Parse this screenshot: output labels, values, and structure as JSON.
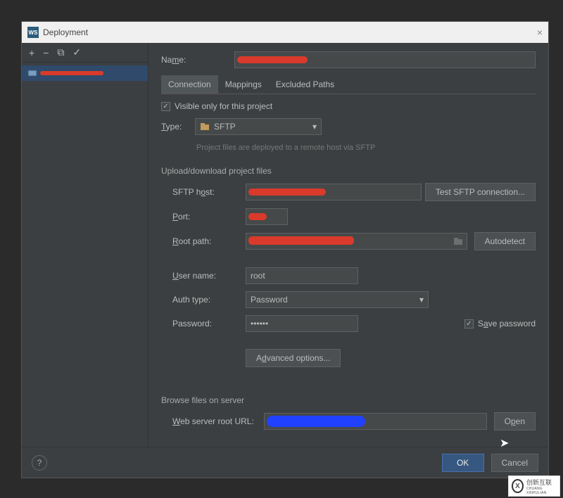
{
  "titlebar": {
    "title": "Deployment",
    "icon_text": "WS"
  },
  "toolbar": {
    "add": "+",
    "remove": "−",
    "copy": "⧉",
    "apply": "✓"
  },
  "sidebar": {
    "item_redacted": true
  },
  "form": {
    "name_label": "Name:",
    "tabs": {
      "connection": "Connection",
      "mappings": "Mappings",
      "excluded": "Excluded Paths"
    },
    "visible_only": "Visible only for this project",
    "type_label": "Type:",
    "type_value": "SFTP",
    "type_hint": "Project files are deployed to a remote host via SFTP",
    "section_upload": "Upload/download project files",
    "sftp_host_label": "SFTP host:",
    "test_btn": "Test SFTP connection...",
    "port_label": "Port:",
    "root_path_label": "Root path:",
    "autodetect_btn": "Autodetect",
    "user_label": "User name:",
    "user_value": "root",
    "auth_label": "Auth type:",
    "auth_value": "Password",
    "password_label": "Password:",
    "password_value": "••••••",
    "save_password": "Save password",
    "advanced_btn": "Advanced options...",
    "section_browse": "Browse files on server",
    "web_url_label": "Web server root URL:",
    "open_btn": "Open"
  },
  "footer": {
    "ok": "OK",
    "cancel": "Cancel",
    "help": "?"
  },
  "watermark": {
    "logo": "X",
    "line1": "创新互联",
    "line2": "CHUANG XINHULIAN"
  }
}
